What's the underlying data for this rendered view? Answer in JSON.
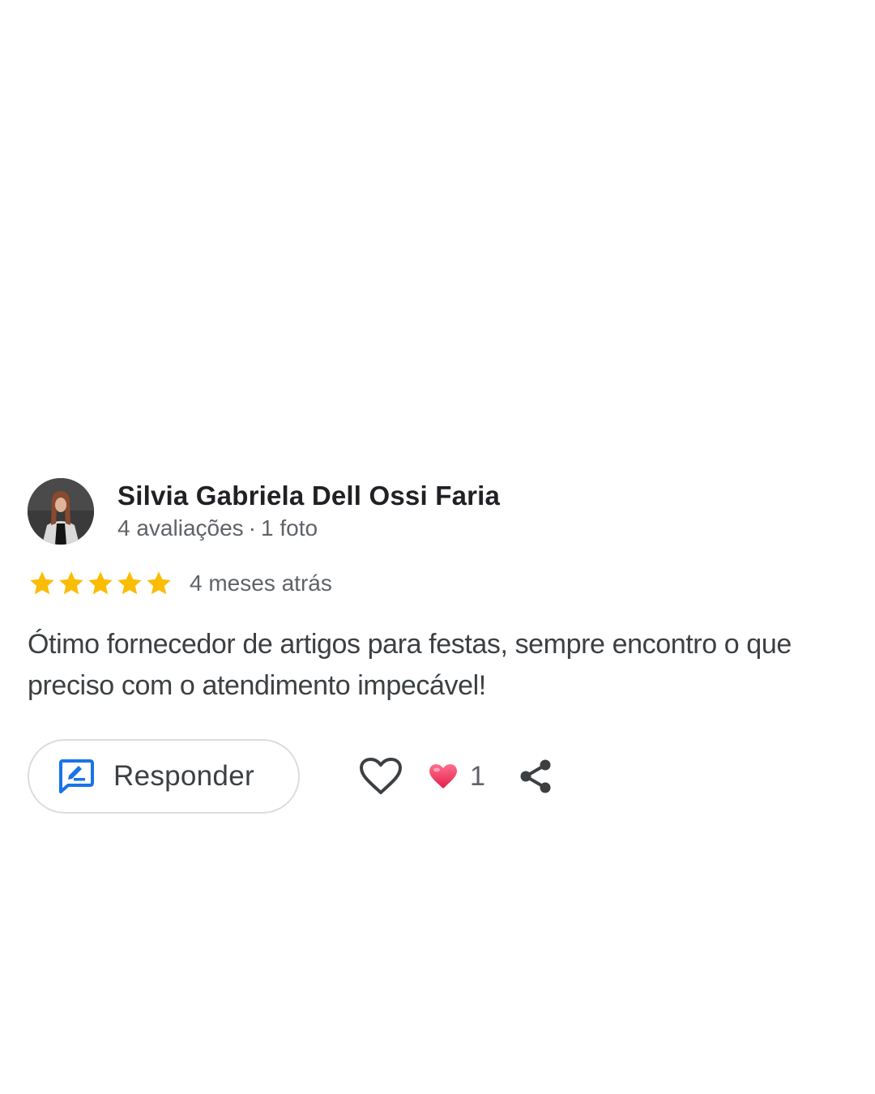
{
  "review": {
    "author": {
      "name": "Silvia Gabriela Dell Ossi Faria",
      "reviews_count": "4 avaliações",
      "separator": "·",
      "photos_count": "1 foto",
      "avatar_icon": "profile-photo"
    },
    "rating": {
      "stars": 5,
      "max_stars": 5,
      "star_color": "#fbbc04"
    },
    "time_ago": "4 meses atrás",
    "text": "Ótimo fornecedor de artigos para festas, sempre encontro o que preciso com o atendimento impecável!",
    "actions": {
      "reply_label": "Responder",
      "reply_icon": "reply-edit-icon",
      "like_icon": "heart-outline-icon",
      "reaction_icon": "heart-filled-icon",
      "reaction_count": "1",
      "share_icon": "share-icon"
    }
  },
  "colors": {
    "accent_blue": "#1a73e8",
    "reaction_red": "#e8385e",
    "text_primary": "#202124",
    "text_secondary": "#5f6368"
  }
}
